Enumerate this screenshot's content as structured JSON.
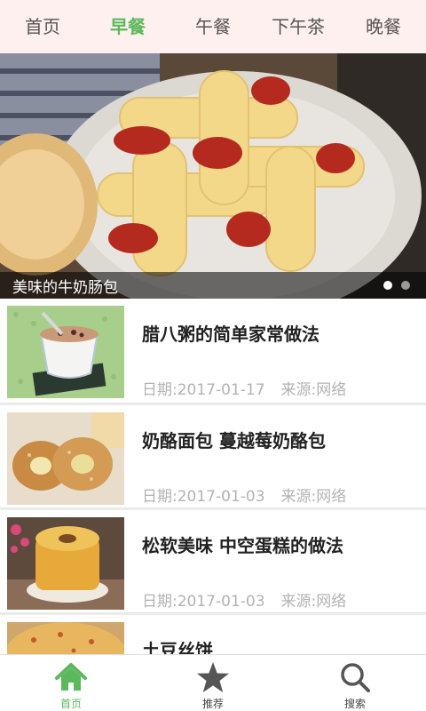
{
  "tabs": [
    {
      "label": "首页"
    },
    {
      "label": "早餐"
    },
    {
      "label": "午餐"
    },
    {
      "label": "下午茶"
    },
    {
      "label": "晚餐"
    }
  ],
  "active_tab": "早餐",
  "banner": {
    "caption": "美味的牛奶肠包",
    "slide_count": 2,
    "active_slide": 1
  },
  "articles": [
    {
      "title": "腊八粥的简单家常做法",
      "date": "日期:2017-01-17",
      "source": "来源:网络",
      "thumb_icon": "porridge-image"
    },
    {
      "title": "奶酪面包 蔓越莓奶酪包",
      "date": "日期:2017-01-03",
      "source": "来源:网络",
      "thumb_icon": "cheese-bread-image"
    },
    {
      "title": "松软美味 中空蛋糕的做法",
      "date": "日期:2017-01-03",
      "source": "来源:网络",
      "thumb_icon": "chiffon-cake-image"
    },
    {
      "title": "土豆丝饼",
      "date": "",
      "source": "",
      "thumb_icon": "potato-pancake-image"
    }
  ],
  "bottom_nav": {
    "home": {
      "label": "首页",
      "icon": "home-icon"
    },
    "recommend": {
      "label": "推荐",
      "icon": "star-icon"
    },
    "search": {
      "label": "搜索",
      "icon": "search-icon"
    }
  },
  "colors": {
    "accent": "#5cb85c",
    "tabbar_bg": "#fdf0ef",
    "meta_text": "#b3b3b3"
  }
}
